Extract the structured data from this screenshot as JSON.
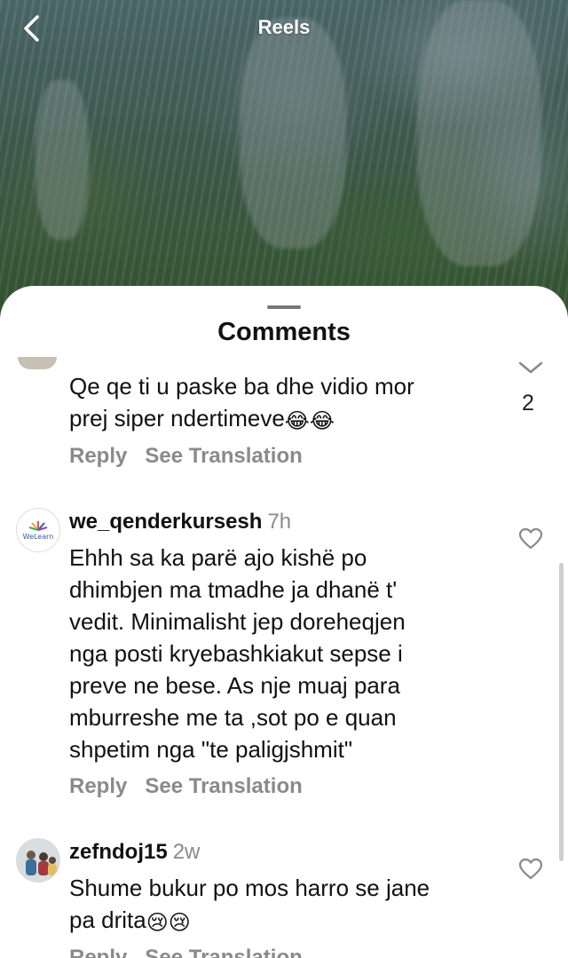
{
  "header": {
    "title": "Reels",
    "back_icon": "chevron-left-icon"
  },
  "sheet": {
    "title": "Comments"
  },
  "comments": [
    {
      "lines": [
        "Qe qe ti u paske ba dhe vidio mor",
        "prej siper ndertimeve"
      ],
      "emoji_end": "😂😂",
      "reply_label": "Reply",
      "translate_label": "See Translation",
      "like_count": "2"
    },
    {
      "username": "we_qenderkursesh",
      "time": "7h",
      "avatar_text": "WeLearn",
      "lines": [
        "Ehhh sa ka parë ajo kishë po",
        "dhimbjen ma tmadhe ja dhanë t'",
        "vedit.  Minimalisht jep doreheqjen",
        "nga posti kryebashkiakut sepse i",
        "preve ne bese. As nje muaj para",
        "mburreshe me ta ,sot po e quan",
        "shpetim nga \"te paligjshmit\""
      ],
      "reply_label": "Reply",
      "translate_label": "See Translation"
    },
    {
      "username": "zefndoj15",
      "time": "2w",
      "lines": [
        "Shume  bukur  po mos harro  se jane",
        "pa drita"
      ],
      "emoji_end": "😢😢",
      "reply_label": "Reply",
      "translate_label": "See Translation"
    }
  ],
  "colors": {
    "text": "#111111",
    "muted": "#8a8a8a",
    "sheet_bg": "#ffffff"
  }
}
